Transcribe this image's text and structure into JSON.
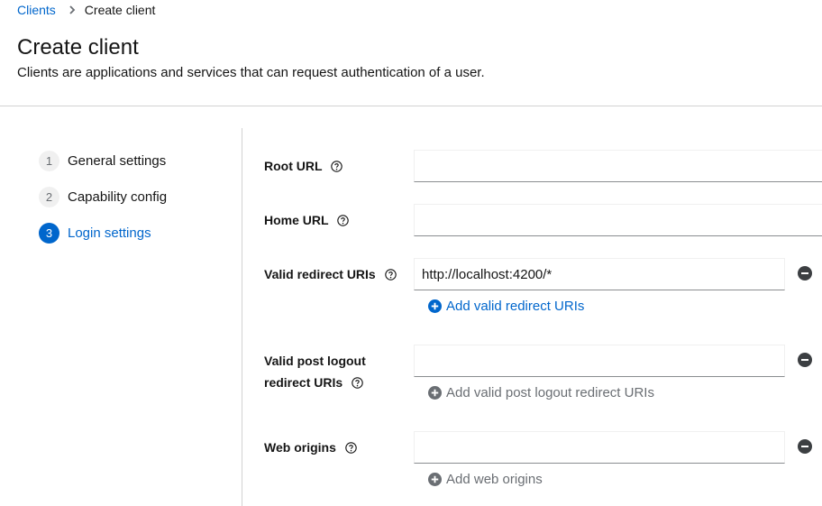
{
  "breadcrumb": {
    "parent": "Clients",
    "current": "Create client"
  },
  "header": {
    "title": "Create client",
    "description": "Clients are applications and services that can request authentication of a user."
  },
  "steps": [
    {
      "number": "1",
      "label": "General settings"
    },
    {
      "number": "2",
      "label": "Capability config"
    },
    {
      "number": "3",
      "label": "Login settings"
    }
  ],
  "active_step": 3,
  "form": {
    "root_url": {
      "label": "Root URL",
      "value": ""
    },
    "home_url": {
      "label": "Home URL",
      "value": ""
    },
    "valid_redirect_uris": {
      "label": "Valid redirect URIs",
      "value": "http://localhost:4200/*",
      "add_label": "Add valid redirect URIs"
    },
    "valid_post_logout": {
      "label_line1": "Valid post logout",
      "label_line2": "redirect URIs",
      "value": "",
      "add_label": "Add valid post logout redirect URIs"
    },
    "web_origins": {
      "label": "Web origins",
      "value": "",
      "add_label": "Add web origins"
    }
  },
  "colors": {
    "accent": "#0066cc",
    "disabled": "#6a6e73",
    "text": "#151515",
    "border": "#d2d2d2"
  },
  "icons": {
    "help": "question-circle-icon",
    "remove": "minus-circle-icon",
    "add": "plus-circle-icon",
    "separator": "chevron-right-icon"
  }
}
